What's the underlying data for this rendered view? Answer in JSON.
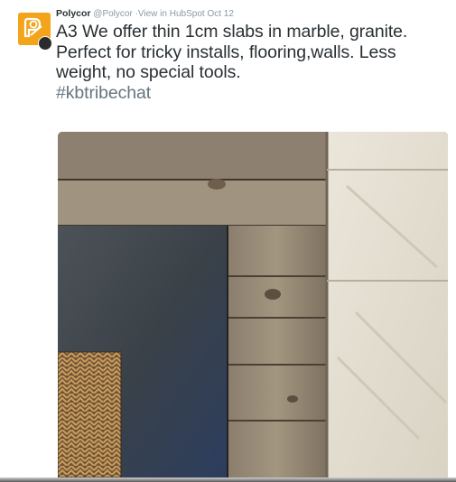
{
  "tweet": {
    "author_name": "Polycor",
    "handle": "@Polycor",
    "via": "·View in HubSpot",
    "date": "Oct 12",
    "text": "A3 We offer thin 1cm slabs in marble, granite. Perfect for tricky installs, flooring,walls. Less weight, no special tools.",
    "hashtag": "#kbtribechat"
  },
  "avatar": {
    "icon": "polycor-logo-icon",
    "color": "#f3a41b"
  },
  "media": {
    "icon": "stone-wood-photo"
  },
  "colors": {
    "text": "#292f33",
    "muted": "#8899a6",
    "hashtag": "#66757f"
  }
}
